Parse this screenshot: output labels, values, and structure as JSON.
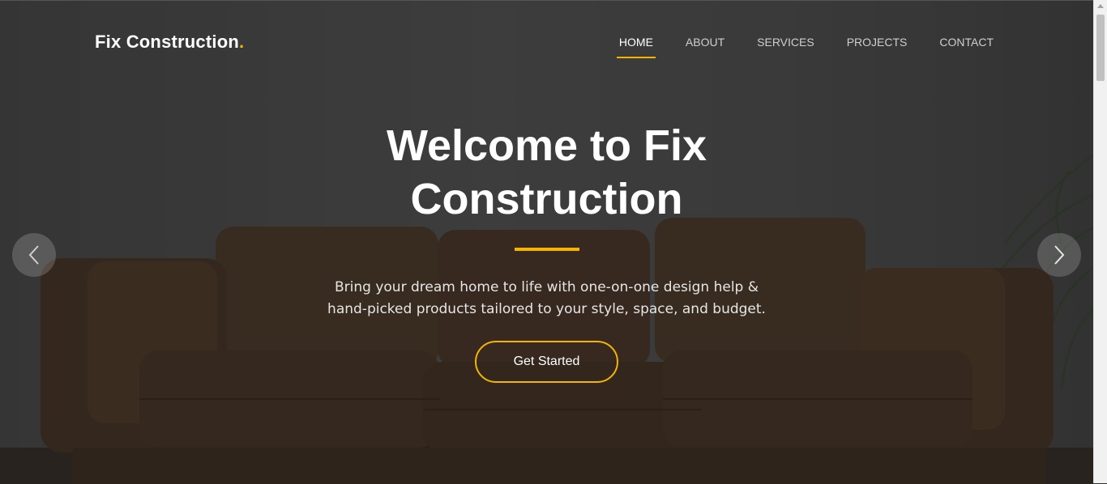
{
  "header": {
    "brand": "Fix Construction",
    "brand_dot": ".",
    "nav": [
      {
        "label": "HOME",
        "active": true
      },
      {
        "label": "ABOUT",
        "active": false
      },
      {
        "label": "SERVICES",
        "active": false
      },
      {
        "label": "PROJECTS",
        "active": false
      },
      {
        "label": "CONTACT",
        "active": false
      }
    ]
  },
  "hero": {
    "title": "Welcome to Fix Construction",
    "subtitle": "Bring your dream home to life with one-on-one design help & hand-picked products tailored to your style, space, and budget.",
    "cta_label": "Get Started"
  },
  "carousel": {
    "prev_icon": "chevron-left-icon",
    "next_icon": "chevron-right-icon"
  },
  "colors": {
    "accent": "#f4b400",
    "text": "#ffffff"
  }
}
